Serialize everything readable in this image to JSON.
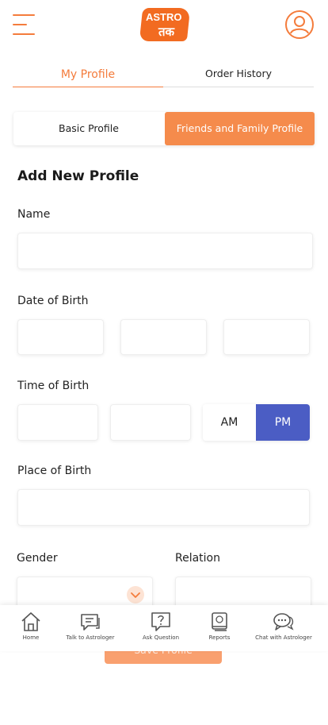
{
  "header": {
    "menu_icon": "hamburger-menu-icon",
    "logo_top": "ASTRO",
    "logo_bottom": "तक",
    "profile_icon": "user-circle-icon",
    "accent_color": "#f47c3c"
  },
  "tabs": [
    {
      "label": "My Profile",
      "active": true
    },
    {
      "label": "Order History",
      "active": false
    }
  ],
  "profile_type": {
    "basic": "Basic Profile",
    "friends": "Friends and Family Profile",
    "selected": "Friends and Family Profile"
  },
  "form": {
    "title": "Add New Profile",
    "name_label": "Name",
    "dob_label": "Date of Birth",
    "tob_label": "Time of Birth",
    "am": "AM",
    "pm": "PM",
    "meridiem_selected": "PM",
    "pob_label": "Place of Birth",
    "gender_label": "Gender",
    "relation_label": "Relation",
    "save": "Save Profile"
  },
  "bottom_nav": [
    {
      "label": "Home",
      "icon": "home-icon"
    },
    {
      "label": "Talk to Astrologer",
      "icon": "chat-bubbles-icon"
    },
    {
      "label": "Ask Question",
      "icon": "question-bubble-icon"
    },
    {
      "label": "Reports",
      "icon": "book-icon"
    },
    {
      "label": "Chat with Astrologer",
      "icon": "chat-dots-icon"
    }
  ],
  "colors": {
    "orange": "#f58b4c",
    "blue": "#4b5dc4"
  }
}
